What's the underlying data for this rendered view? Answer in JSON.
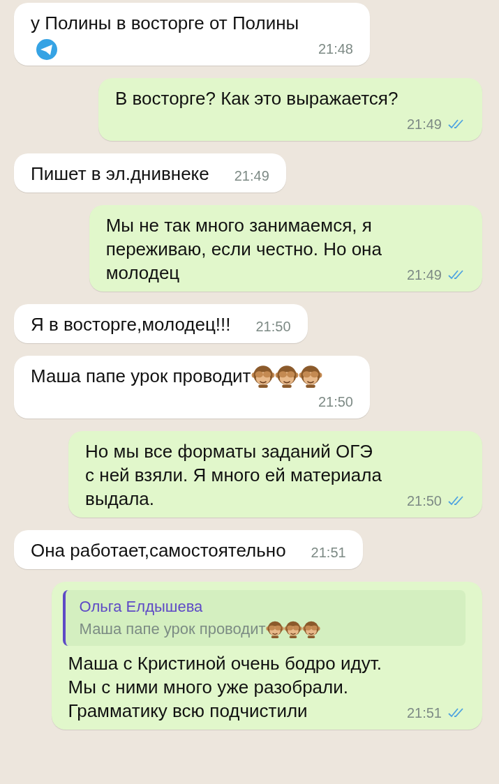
{
  "messages": [
    {
      "kind": "in",
      "text": "у Полины в восторге от Полины",
      "time": "21:48"
    },
    {
      "kind": "out",
      "text": "В восторге? Как это выражается?",
      "time": "21:49",
      "read": true
    },
    {
      "kind": "in",
      "text": "Пишет в эл.днивнеке",
      "time": "21:49"
    },
    {
      "kind": "out",
      "text": "Мы не так много занимаемся, я\nпереживаю, если честно. Но она\nмолодец",
      "time": "21:49",
      "read": true
    },
    {
      "kind": "in",
      "text": "Я в восторге,молодец!!!",
      "time": "21:50"
    },
    {
      "kind": "in",
      "text": "Маша папе урок проводит",
      "time": "21:50",
      "emojis": [
        {
          "kind": "monkey"
        },
        {
          "kind": "monkey"
        },
        {
          "kind": "monkey"
        }
      ]
    },
    {
      "kind": "out",
      "text": "Но мы все форматы заданий ОГЭ\nс ней взяли. Я много ей материала\nвыдала.",
      "time": "21:50",
      "read": true
    },
    {
      "kind": "in",
      "text": "Она работает,самостоятельно",
      "time": "21:51"
    },
    {
      "kind": "out",
      "reply": {
        "author": "Ольга Елдышева",
        "text": "Маша папе урок проводит",
        "emojis": [
          {
            "kind": "monkey"
          },
          {
            "kind": "monkey"
          },
          {
            "kind": "monkey"
          }
        ]
      },
      "text": "Маша с Кристиной очень бодро идут.\nМы с ними много уже разобрали.\nГрамматику всю подчистили",
      "time": "21:51",
      "read": true
    }
  ]
}
